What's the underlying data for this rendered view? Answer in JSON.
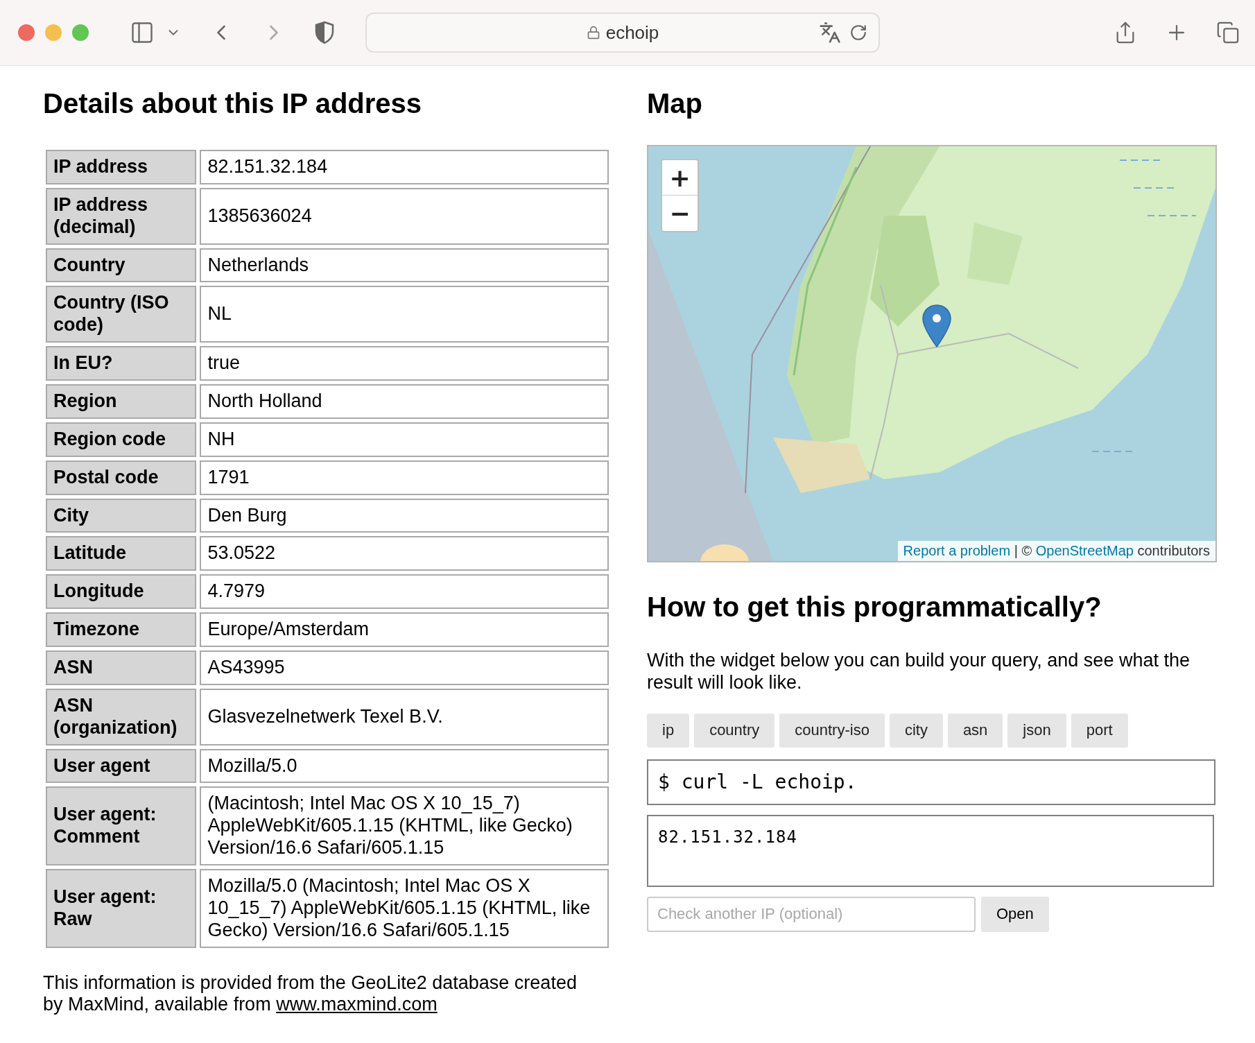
{
  "browser": {
    "address": "echoip"
  },
  "details": {
    "heading": "Details about this IP address",
    "rows": [
      {
        "label": "IP address",
        "value": "82.151.32.184"
      },
      {
        "label": "IP address (decimal)",
        "value": "1385636024"
      },
      {
        "label": "Country",
        "value": "Netherlands"
      },
      {
        "label": "Country (ISO code)",
        "value": "NL"
      },
      {
        "label": "In EU?",
        "value": "true"
      },
      {
        "label": "Region",
        "value": "North Holland"
      },
      {
        "label": "Region code",
        "value": "NH"
      },
      {
        "label": "Postal code",
        "value": "1791"
      },
      {
        "label": "City",
        "value": "Den Burg"
      },
      {
        "label": "Latitude",
        "value": "53.0522"
      },
      {
        "label": "Longitude",
        "value": "4.7979"
      },
      {
        "label": "Timezone",
        "value": "Europe/Amsterdam"
      },
      {
        "label": "ASN",
        "value": "AS43995"
      },
      {
        "label": "ASN (organization)",
        "value": "Glasvezelnetwerk Texel B.V."
      },
      {
        "label": "User agent",
        "value": "Mozilla/5.0"
      },
      {
        "label": "User agent: Comment",
        "value": "(Macintosh; Intel Mac OS X 10_15_7) AppleWebKit/605.1.15 (KHTML, like Gecko) Version/16.6 Safari/605.1.15"
      },
      {
        "label": "User agent: Raw",
        "value": "Mozilla/5.0 (Macintosh; Intel Mac OS X 10_15_7) AppleWebKit/605.1.15 (KHTML, like Gecko) Version/16.6 Safari/605.1.15"
      }
    ],
    "note": "This information is provided from the GeoLite2 database created by MaxMind, available from",
    "note_link": "www.maxmind.com"
  },
  "map": {
    "heading": "Map",
    "zoom_in": "+",
    "zoom_out": "−",
    "report_link": "Report a problem",
    "separator": "| ©",
    "osm_link": "OpenStreetMap",
    "suffix": "contributors"
  },
  "api": {
    "heading": "How to get this programmatically?",
    "intro": "With the widget below you can build your query, and see what the result will look like.",
    "options": [
      "ip",
      "country",
      "country-iso",
      "city",
      "asn",
      "json",
      "port"
    ],
    "command": "$ curl -L echoip.",
    "result": "82.151.32.184",
    "ip_placeholder": "Check another IP (optional)",
    "open_button": "Open"
  }
}
